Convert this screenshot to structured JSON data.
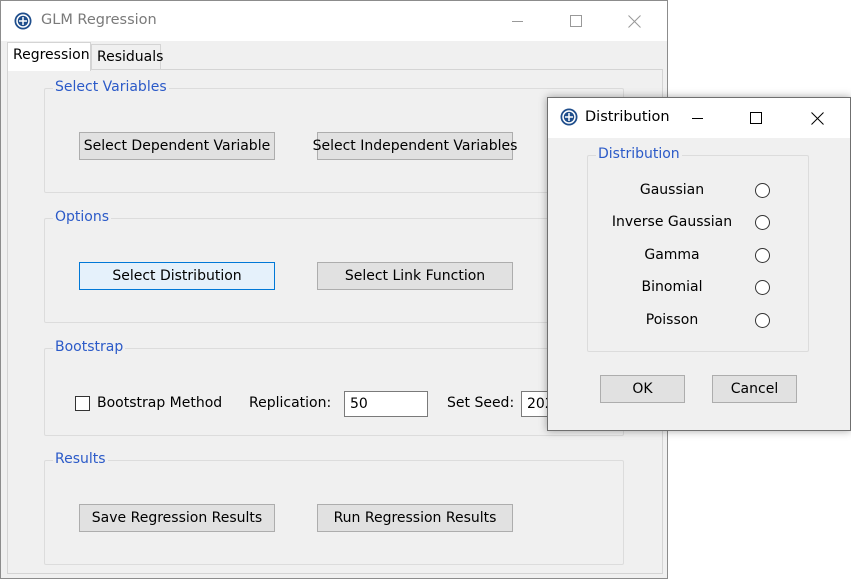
{
  "main_window": {
    "title": "GLM Regression",
    "tabs": [
      {
        "label": "Regression"
      },
      {
        "label": "Residuals"
      }
    ],
    "groups": {
      "select_variables": {
        "legend": "Select Variables",
        "dependent_button": "Select Dependent Variable",
        "independent_button": "Select Independent Variables"
      },
      "options": {
        "legend": "Options",
        "distribution_button": "Select Distribution",
        "link_button": "Select Link Function"
      },
      "bootstrap": {
        "legend": "Bootstrap",
        "method_label": "Bootstrap Method",
        "method_checked": false,
        "replication_label": "Replication:",
        "replication_value": "50",
        "seed_label": "Set Seed:",
        "seed_value": "202"
      },
      "results": {
        "legend": "Results",
        "save_button": "Save Regression Results",
        "run_button": "Run Regression Results"
      }
    }
  },
  "dialog": {
    "title": "Distribution",
    "group_legend": "Distribution",
    "options": [
      {
        "label": "Gaussian",
        "selected": false
      },
      {
        "label": "Inverse Gaussian",
        "selected": false
      },
      {
        "label": "Gamma",
        "selected": false
      },
      {
        "label": "Binomial",
        "selected": false
      },
      {
        "label": "Poisson",
        "selected": false
      }
    ],
    "ok_button": "OK",
    "cancel_button": "Cancel"
  },
  "colors": {
    "legend_text": "#2b5ac8",
    "focus_border": "#0078d7",
    "window_bg": "#f0f0f0"
  },
  "icons": {
    "app_icon": "app-logo-icon",
    "minimize": "minimize-icon",
    "maximize": "maximize-icon",
    "close": "close-icon"
  }
}
